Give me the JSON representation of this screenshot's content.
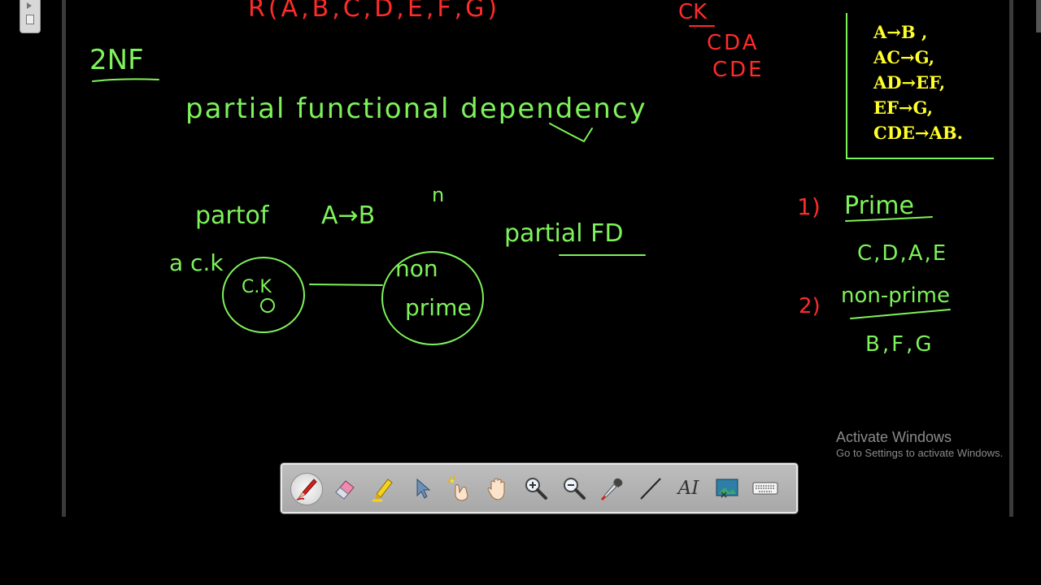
{
  "board": {
    "top_formula": "R(A,B,C,D,E,F,G)",
    "heading": "2NF",
    "title": "partial functional dependency",
    "partof_label": "partof",
    "dependency_example": "A→B",
    "candidate_key_note": "a c.k",
    "stray_mark": "n",
    "circle_left_label": "C.K",
    "circle_right_label_line1": "non",
    "circle_right_label_line2": "prime",
    "partial_fd_label": "partial FD",
    "ck_label": "CK",
    "ck_values": [
      "CDA",
      "CDE"
    ],
    "item1_number": "1)",
    "item1_label": "Prime",
    "item1_values": "C,D,A,E",
    "item2_number": "2)",
    "item2_label": "non-prime",
    "item2_values": "B,F,G"
  },
  "fd_box": {
    "items": [
      "A→B ,",
      "AC→G,",
      "AD→EF,",
      "EF→G,",
      "CDE→AB."
    ]
  },
  "watermark": {
    "title": "Activate Windows",
    "subtitle": "Go to Settings to activate Windows."
  },
  "toolbar": {
    "tools": [
      {
        "name": "pen-tool-icon",
        "active": true
      },
      {
        "name": "eraser-tool-icon",
        "active": false
      },
      {
        "name": "highlighter-tool-icon",
        "active": false
      },
      {
        "name": "pointer-tool-icon",
        "active": false
      },
      {
        "name": "laser-pointer-tool-icon",
        "active": false
      },
      {
        "name": "pan-hand-tool-icon",
        "active": false
      },
      {
        "name": "zoom-in-tool-icon",
        "active": false
      },
      {
        "name": "zoom-out-tool-icon",
        "active": false
      },
      {
        "name": "eyedropper-tool-icon",
        "active": false
      },
      {
        "name": "line-tool-icon",
        "active": false
      },
      {
        "name": "text-tool-icon",
        "active": false
      },
      {
        "name": "screen-capture-tool-icon",
        "active": false
      },
      {
        "name": "keyboard-tool-icon",
        "active": false
      }
    ],
    "text_tool_glyph": "AI"
  },
  "colors": {
    "ink_green": "#7ef25a",
    "ink_red": "#ff2b2b",
    "fd_yellow": "#ffff2a",
    "background": "#000000"
  }
}
